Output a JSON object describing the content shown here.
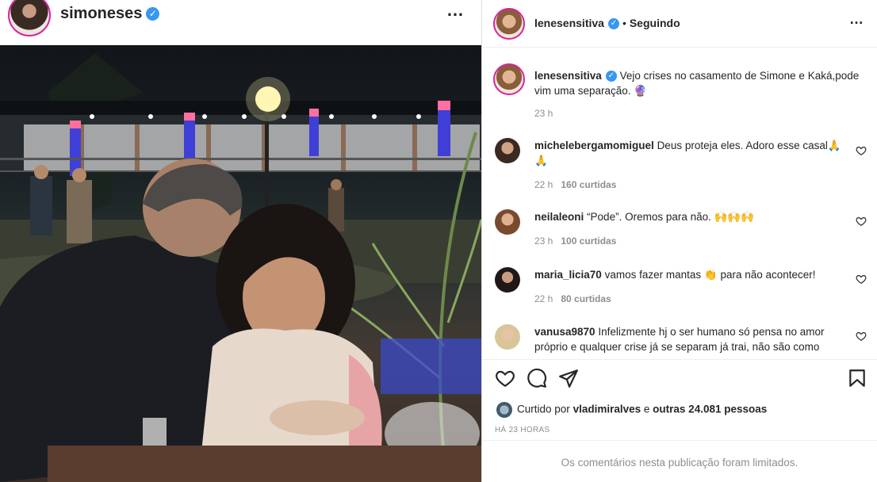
{
  "post_header": {
    "username": "simoneses",
    "verified_mark": "✓",
    "more_icon": "…"
  },
  "author": {
    "username": "lenesensitiva",
    "follow_status": "Seguindo"
  },
  "caption": {
    "username": "lenesensitiva",
    "text": "Vejo crises no casamento de Simone e Kaká,pode vim uma separação. 🔮",
    "time": "23 h"
  },
  "comments": [
    {
      "username": "michelebergamomiguel",
      "text": "Deus proteja eles. Adoro esse casal🙏 🙏",
      "time": "22 h",
      "likes": "160 curtidas"
    },
    {
      "username": "neilaleoni",
      "text": "“Pode”. Oremos para não. 🙌🙌🙌",
      "time": "23 h",
      "likes": "100 curtidas"
    },
    {
      "username": "maria_licia70",
      "text": "vamos fazer mantas 👏 para não acontecer!",
      "time": "22 h",
      "likes": "80 curtidas"
    },
    {
      "username": "vanusa9870",
      "text": "Infelizmente hj o ser humano só pensa no amor próprio e qualquer crise já se separam já trai, não são como",
      "time": "",
      "likes": ""
    }
  ],
  "likes_line": {
    "prefix": "Curtido por",
    "user": "vladimiralves",
    "middle": "e",
    "others": "outras 24.081 pessoas"
  },
  "time_ago": "HÁ 23 HORAS",
  "comments_limited": "Os comentários nesta publicação foram limitados.",
  "colors": {
    "verified": "#3897f0",
    "story_ring": "#d6249f",
    "muted": "#8e8e8e",
    "text": "#262626"
  },
  "icons": [
    "heart-icon",
    "comment-icon",
    "share-icon",
    "bookmark-icon",
    "more-icon",
    "verified-icon"
  ]
}
